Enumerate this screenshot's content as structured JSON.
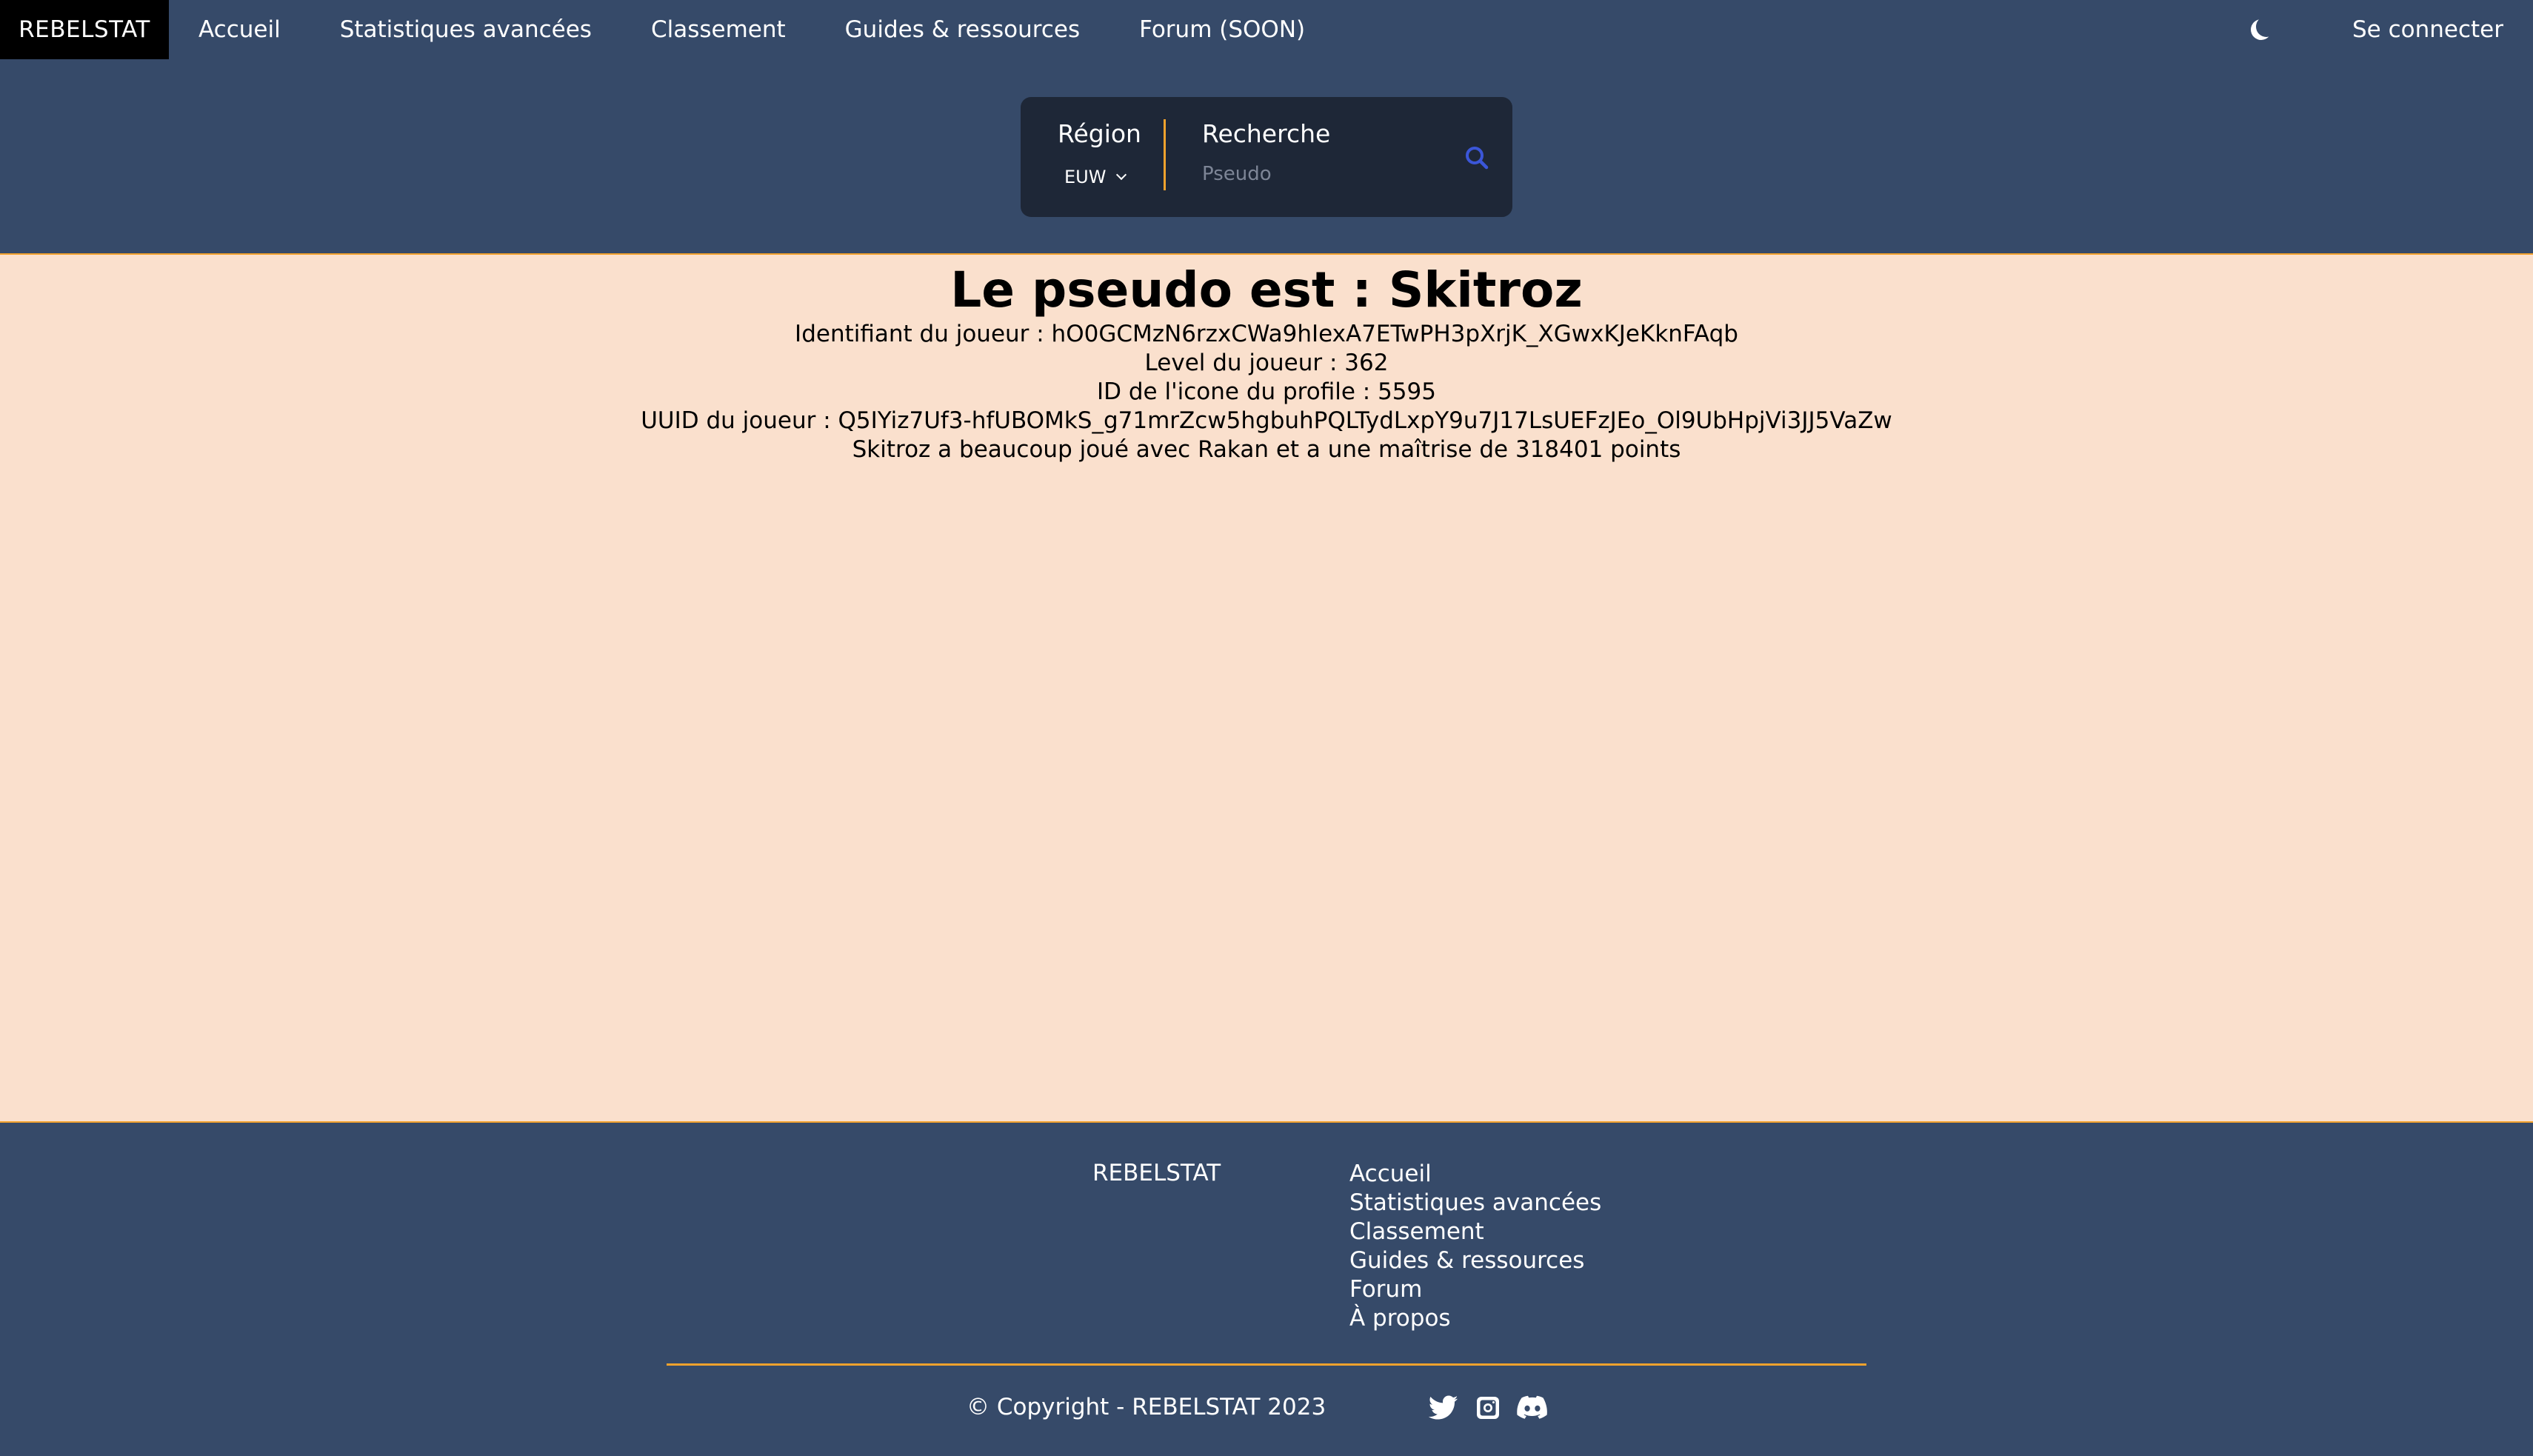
{
  "nav": {
    "brand": "REBELSTAT",
    "links": [
      "Accueil",
      "Statistiques avancées",
      "Classement",
      "Guides & ressources",
      "Forum (SOON)"
    ],
    "theme_icon": "moon-icon",
    "login": "Se connecter"
  },
  "search": {
    "region_label": "Région",
    "region_value": "EUW",
    "search_label": "Recherche",
    "placeholder": "Pseudo",
    "icon": "search-icon"
  },
  "player": {
    "title": "Le pseudo est : Skitroz",
    "identifiant": "Identifiant du joueur : hO0GCMzN6rzxCWa9hIexA7ETwPH3pXrjK_XGwxKJeKknFAqb",
    "level": "Level du joueur : 362",
    "icon_id": "ID de l'icone du profile : 5595",
    "uuid": "UUID du joueur : Q5IYiz7Uf3-hfUBOMkS_g71mrZcw5hgbuhPQLTydLxpY9u7J17LsUEFzJEo_Ol9UbHpjVi3JJ5VaZw",
    "mastery": "Skitroz a beaucoup joué avec Rakan et a une maîtrise de 318401 points"
  },
  "footer": {
    "brand": "REBELSTAT",
    "links": [
      "Accueil",
      "Statistiques avancées",
      "Classement",
      "Guides & ressources",
      "Forum",
      "À propos"
    ],
    "copyright": "© Copyright - REBELSTAT 2023",
    "social_icons": [
      "twitter-icon",
      "instagram-icon",
      "discord-icon"
    ]
  },
  "colors": {
    "header_bg": "#364a69",
    "main_bg": "#fae0cd",
    "accent": "#f2a22d",
    "search_bg": "#1e2737",
    "brand_bg": "#000000"
  }
}
